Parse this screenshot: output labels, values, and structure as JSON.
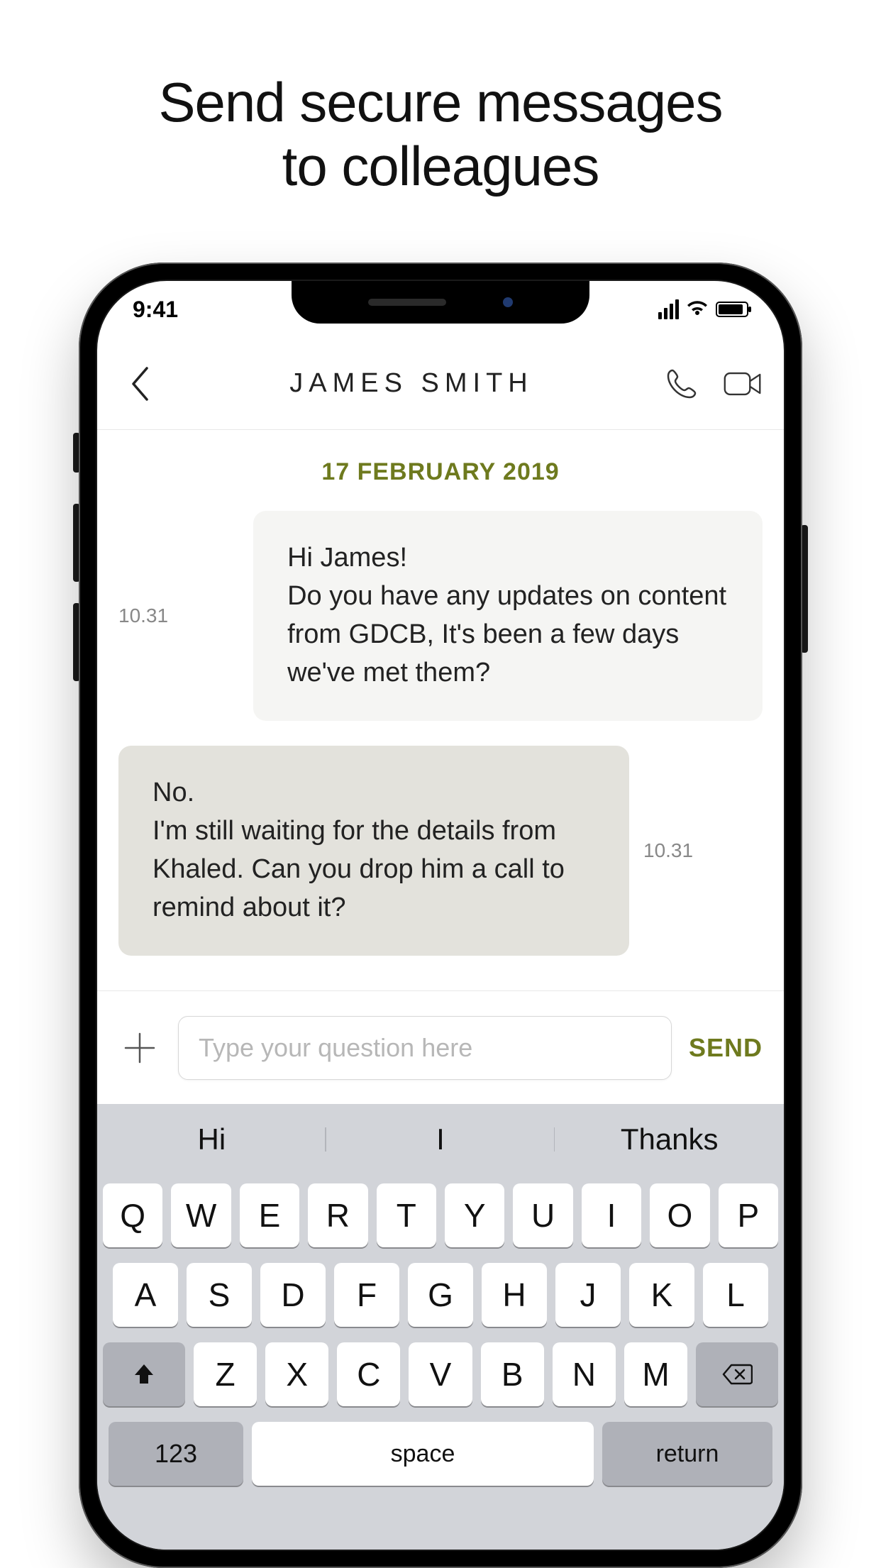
{
  "promo": {
    "line1": "Send secure messages",
    "line2": "to colleagues"
  },
  "status": {
    "time": "9:41"
  },
  "header": {
    "contact_name": "JAMES SMITH"
  },
  "chat": {
    "date_separator": "17 FEBRUARY 2019",
    "messages": [
      {
        "time": "10.31",
        "side": "sent",
        "text": "Hi James!\nDo you have any updates on content from GDCB, It's been a few days we've met them?"
      },
      {
        "time": "10.31",
        "side": "recv",
        "text": "No.\nI'm still waiting for the details from Khaled. Can you drop him a call to remind about it?"
      }
    ]
  },
  "compose": {
    "placeholder": "Type your question here",
    "send_label": "SEND"
  },
  "keyboard": {
    "suggestions": [
      "Hi",
      "I",
      "Thanks"
    ],
    "row1": [
      "Q",
      "W",
      "E",
      "R",
      "T",
      "Y",
      "U",
      "I",
      "O",
      "P"
    ],
    "row2": [
      "A",
      "S",
      "D",
      "F",
      "G",
      "H",
      "J",
      "K",
      "L"
    ],
    "row3": [
      "Z",
      "X",
      "C",
      "V",
      "B",
      "N",
      "M"
    ],
    "num_key": "123",
    "space_key": "space",
    "return_key": "return"
  },
  "colors": {
    "accent": "#6e7a1e"
  }
}
